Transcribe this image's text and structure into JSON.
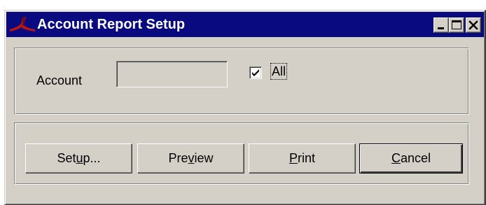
{
  "window": {
    "title": "Account Report Setup",
    "title_bar_color": "#0a0a80",
    "face_color": "#d4d0c8"
  },
  "titlebar_buttons": {
    "minimize_icon": "minimize-icon",
    "maximize_icon": "maximize-icon",
    "close_icon": "close-icon"
  },
  "form": {
    "account_label": "Account",
    "account_value": "",
    "all_label": "All",
    "all_checked": true
  },
  "buttons": {
    "setup": {
      "before": "Set",
      "mnemonic": "u",
      "after": "p..."
    },
    "preview": {
      "before": "Pre",
      "mnemonic": "v",
      "after": "iew"
    },
    "print": {
      "before": "",
      "mnemonic": "P",
      "after": "rint"
    },
    "cancel": {
      "before": "",
      "mnemonic": "C",
      "after": "ancel"
    }
  }
}
